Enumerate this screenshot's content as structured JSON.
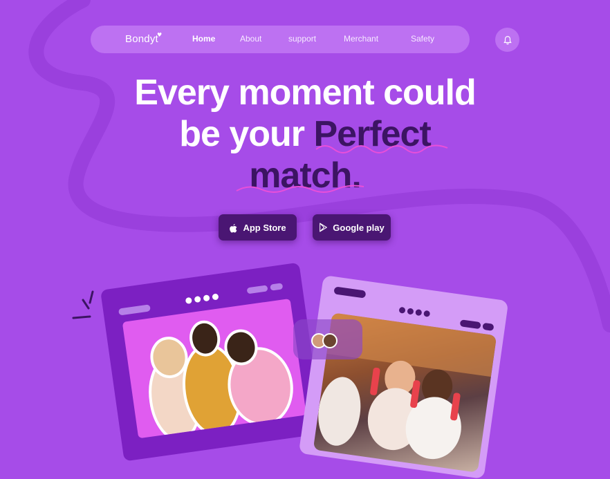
{
  "nav": {
    "logo": "Bondyt",
    "links": [
      "Home",
      "About",
      "support",
      "Merchant",
      "Safety"
    ],
    "active": "Home"
  },
  "hero": {
    "line1": "Every moment could",
    "line2a": "be your ",
    "line2b": "Perfect",
    "line3": "match."
  },
  "buttons": {
    "app_store": "App Store",
    "google_play": "Google play"
  },
  "colors": {
    "background": "#a64ce8",
    "accent_dark": "#3c1463",
    "button": "#4a1673",
    "squiggle": "#e94fd9"
  },
  "icons": {
    "bell": "bell-icon",
    "apple": "apple-icon",
    "play": "google-play-icon"
  }
}
